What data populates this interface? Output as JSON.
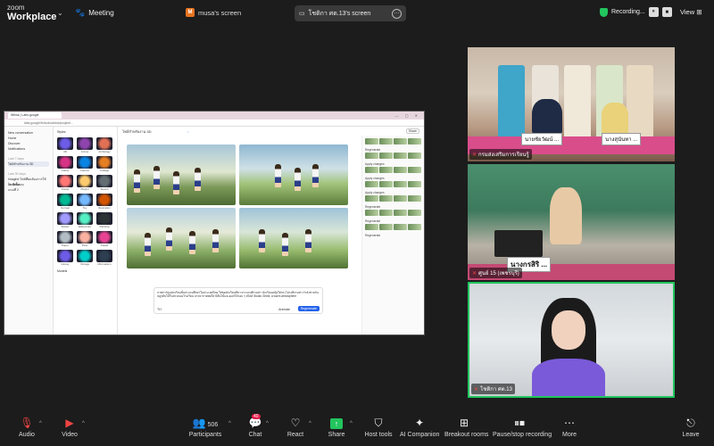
{
  "app": {
    "logo_line1": "zoom",
    "logo_line2": "Workplace",
    "meeting_label": "Meeting"
  },
  "screen_owner": "musa's screen",
  "viewing_pill": "โชติกา ศต.13's screen",
  "recording": {
    "label": "Recording...",
    "pause": "⏸",
    "stop": "■"
  },
  "view_label": "View",
  "shared_app": {
    "tab": "Whisk | Labs.google",
    "address": "labs.google/fx/tools/whisk/project/...",
    "nav": [
      "New conversation",
      "Home",
      "Discover",
      "Notifications"
    ],
    "nav_section1": "Last 7 days",
    "nav_active": "ไฟล์สำหรับงาน 3D",
    "nav_section2": "Last 30 days",
    "nav_items2": [
      "Imagine ไฟล์ที่ผมต้องการใช้ใน ผีเสื้อ...",
      "แบบทดสอบ",
      "แบบที่ 2"
    ],
    "panel_title": "Styles",
    "styles": [
      "3D",
      "Anime",
      "Anthology",
      "Clarity",
      "Cartoon",
      "Collage",
      "Pastel",
      "Playful",
      "Sketch",
      "Surreal",
      "Toy",
      "Illustration",
      "Sticker",
      "Watercolor",
      "Painting",
      "Paper",
      "Pixel",
      "Pastel",
      "Glossy",
      "Vintage",
      "Minimalism"
    ],
    "models_label": "Models",
    "project_title": "ไฟล์สำหรับงาน 3D",
    "share": "Share",
    "prompt": "ภาพการ์ตูนนักเรียนชั้นประถมศึกษาในประเทศไทย ใส่ชุดนักเรียนสีขาวกางเกงสีกรมท่า นักเรียนหญิงใส่กระโปรงสีกรมท่า กำลังช่วยกันปลูกต้นไม้ในสวนของโรงเรียน บรรยากาศสดใส มีต้นไม้และดอกไม้รอบ ๆ สไตล์ Studio Ghibli, a warm atmosphere",
    "prompt_lang": "TH",
    "animate": "Animate",
    "regenerate": "Regenerate",
    "strip_labels": [
      "Regenerate",
      "Apply changes",
      "Apply changes",
      "Apply changes",
      "Regenerate",
      "Regenerate",
      "Regenerate"
    ]
  },
  "participants_video": [
    {
      "name": "กรมส่งเสริมการเรียนรู้",
      "namecards": [
        "นายชัยวัฒน์ ...",
        "นางสุนันทา ..."
      ]
    },
    {
      "name": "ศูนย์ 15 (เพชรบุรี)",
      "namecards": [
        "นางกรสิริ ..."
      ]
    },
    {
      "name": "โชติกา ศต.13"
    }
  ],
  "toolbar": {
    "audio": "Audio",
    "video": "Video",
    "participants": "Participants",
    "participant_count": "506",
    "chat": "Chat",
    "chat_badge": "40",
    "react": "React",
    "share": "Share",
    "host_tools": "Host tools",
    "ai_companion": "AI Companion",
    "breakout": "Breakout rooms",
    "pause_rec": "Pause/stop recording",
    "more": "More",
    "leave": "Leave"
  },
  "colors": {
    "share_green": "#22c55e",
    "leave_red": "#ef4444",
    "active_speaker": "#22c55e",
    "chat_badge": "#e11d48"
  }
}
